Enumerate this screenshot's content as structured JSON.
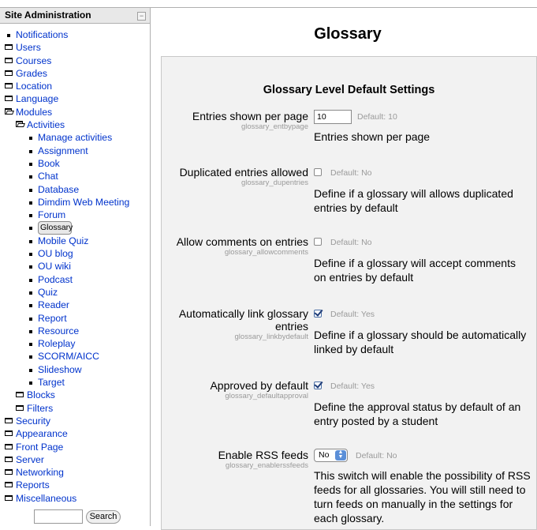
{
  "sidebar": {
    "title": "Site Administration",
    "collapse_symbol": "−",
    "items": [
      {
        "label": "Notifications",
        "icon": "bullet"
      },
      {
        "label": "Users",
        "icon": "folder"
      },
      {
        "label": "Courses",
        "icon": "folder"
      },
      {
        "label": "Grades",
        "icon": "folder"
      },
      {
        "label": "Location",
        "icon": "folder"
      },
      {
        "label": "Language",
        "icon": "folder"
      },
      {
        "label": "Modules",
        "icon": "folder-open"
      },
      {
        "label": "Activities",
        "icon": "folder-open"
      },
      {
        "label": "Manage activities",
        "icon": "bullet"
      },
      {
        "label": "Assignment",
        "icon": "bullet"
      },
      {
        "label": "Book",
        "icon": "bullet"
      },
      {
        "label": "Chat",
        "icon": "bullet"
      },
      {
        "label": "Database",
        "icon": "bullet"
      },
      {
        "label": "Dimdim Web Meeting",
        "icon": "bullet"
      },
      {
        "label": "Forum",
        "icon": "bullet"
      },
      {
        "label": "Glossary",
        "icon": "bullet",
        "selected": true
      },
      {
        "label": "Mobile Quiz",
        "icon": "bullet"
      },
      {
        "label": "OU blog",
        "icon": "bullet"
      },
      {
        "label": "OU wiki",
        "icon": "bullet"
      },
      {
        "label": "Podcast",
        "icon": "bullet"
      },
      {
        "label": "Quiz",
        "icon": "bullet"
      },
      {
        "label": "Reader",
        "icon": "bullet"
      },
      {
        "label": "Report",
        "icon": "bullet"
      },
      {
        "label": "Resource",
        "icon": "bullet"
      },
      {
        "label": "Roleplay",
        "icon": "bullet"
      },
      {
        "label": "SCORM/AICC",
        "icon": "bullet"
      },
      {
        "label": "Slideshow",
        "icon": "bullet"
      },
      {
        "label": "Target",
        "icon": "bullet"
      },
      {
        "label": "Blocks",
        "icon": "folder"
      },
      {
        "label": "Filters",
        "icon": "folder"
      },
      {
        "label": "Security",
        "icon": "folder"
      },
      {
        "label": "Appearance",
        "icon": "folder"
      },
      {
        "label": "Front Page",
        "icon": "folder"
      },
      {
        "label": "Server",
        "icon": "folder"
      },
      {
        "label": "Networking",
        "icon": "folder"
      },
      {
        "label": "Reports",
        "icon": "folder"
      },
      {
        "label": "Miscellaneous",
        "icon": "folder"
      }
    ],
    "search": {
      "value": "",
      "button_label": "Search"
    }
  },
  "main": {
    "title": "Glossary",
    "panel_heading": "Glossary Level Default Settings",
    "settings": [
      {
        "label": "Entries shown per page",
        "name": "glossary_entbypage",
        "control": "text",
        "value": "10",
        "default": "Default: 10",
        "description": "Entries shown per page"
      },
      {
        "label": "Duplicated entries allowed",
        "name": "glossary_dupentries",
        "control": "checkbox",
        "checked": false,
        "default": "Default: No",
        "description": "Define if a glossary will allows duplicated entries by default"
      },
      {
        "label": "Allow comments on entries",
        "name": "glossary_allowcomments",
        "control": "checkbox",
        "checked": false,
        "default": "Default: No",
        "description": "Define if a glossary will accept comments on entries by default"
      },
      {
        "label": "Automatically link glossary entries",
        "name": "glossary_linkbydefault",
        "control": "checkbox",
        "checked": true,
        "default": "Default: Yes",
        "description": "Define if a glossary should be automatically linked by default"
      },
      {
        "label": "Approved by default",
        "name": "glossary_defaultapproval",
        "control": "checkbox",
        "checked": true,
        "default": "Default: Yes",
        "description": "Define the approval status by default of an entry posted by a student"
      },
      {
        "label": "Enable RSS feeds",
        "name": "glossary_enablerssfeeds",
        "control": "select",
        "value": "No",
        "default": "Default: No",
        "description": "This switch will enable the possibility of RSS feeds for all glossaries. You will still need to turn feeds on manually in the settings for each glossary."
      }
    ]
  },
  "colors": {
    "link": "#0033cc",
    "panel_bg": "#f2f2f2",
    "muted": "#9a9a9a",
    "select_arrow": "#5b8fd8"
  }
}
